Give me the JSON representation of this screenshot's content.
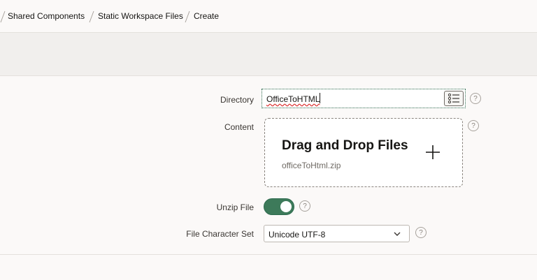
{
  "breadcrumb": {
    "items": [
      "Shared Components",
      "Static Workspace Files",
      "Create"
    ]
  },
  "form": {
    "directory": {
      "label": "Directory",
      "value": "OfficeToHTML",
      "help": "?"
    },
    "content": {
      "label": "Content",
      "dropzone_title": "Drag and Drop Files",
      "file_name": "officeToHtml.zip",
      "help": "?"
    },
    "unzip": {
      "label": "Unzip File",
      "checked": true,
      "help": "?"
    },
    "charset": {
      "label": "File Character Set",
      "value": "Unicode UTF-8",
      "help": "?"
    }
  },
  "colors": {
    "accent": "#3d7a5a",
    "focus_border": "#2e6b4f",
    "toolbar_band": "#f1efed"
  },
  "icons": {
    "list_picker": "list-icon",
    "add": "plus-icon",
    "dropdown": "chevron-down-icon",
    "help": "help-icon"
  }
}
